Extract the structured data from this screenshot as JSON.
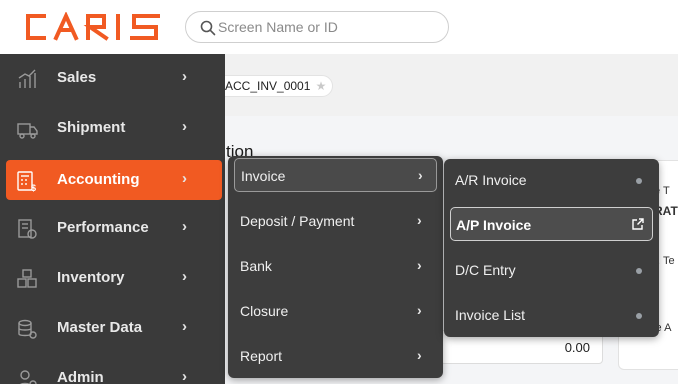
{
  "header": {
    "logo_text": "CARIS",
    "search_placeholder": "Screen Name or ID"
  },
  "tab": {
    "label": "ACC_INV_0001"
  },
  "background": {
    "title_fragment": "tion",
    "right_fragment_1": "e T",
    "right_fragment_2": "RAT",
    "right_fragment_3": "t. Te",
    "right_fragment_4": "ce A",
    "amount": "0.00"
  },
  "sidebar": {
    "items": [
      {
        "label": "Sales",
        "icon": "chart-icon"
      },
      {
        "label": "Shipment",
        "icon": "truck-icon"
      },
      {
        "label": "Accounting",
        "icon": "calculator-icon"
      },
      {
        "label": "Performance",
        "icon": "report-icon"
      },
      {
        "label": "Inventory",
        "icon": "boxes-icon"
      },
      {
        "label": "Master Data",
        "icon": "database-icon"
      },
      {
        "label": "Admin",
        "icon": "user-icon"
      }
    ]
  },
  "submenu": {
    "items": [
      {
        "label": "Invoice"
      },
      {
        "label": "Deposit / Payment"
      },
      {
        "label": "Bank"
      },
      {
        "label": "Closure"
      },
      {
        "label": "Report"
      }
    ]
  },
  "submenu2": {
    "items": [
      {
        "label": "A/R Invoice"
      },
      {
        "label": "A/P Invoice"
      },
      {
        "label": "D/C Entry"
      },
      {
        "label": "Invoice List"
      }
    ]
  },
  "colors": {
    "brand": "#f15a22",
    "sidebar": "#3a3a3a",
    "menu": "#3d3d3d"
  }
}
